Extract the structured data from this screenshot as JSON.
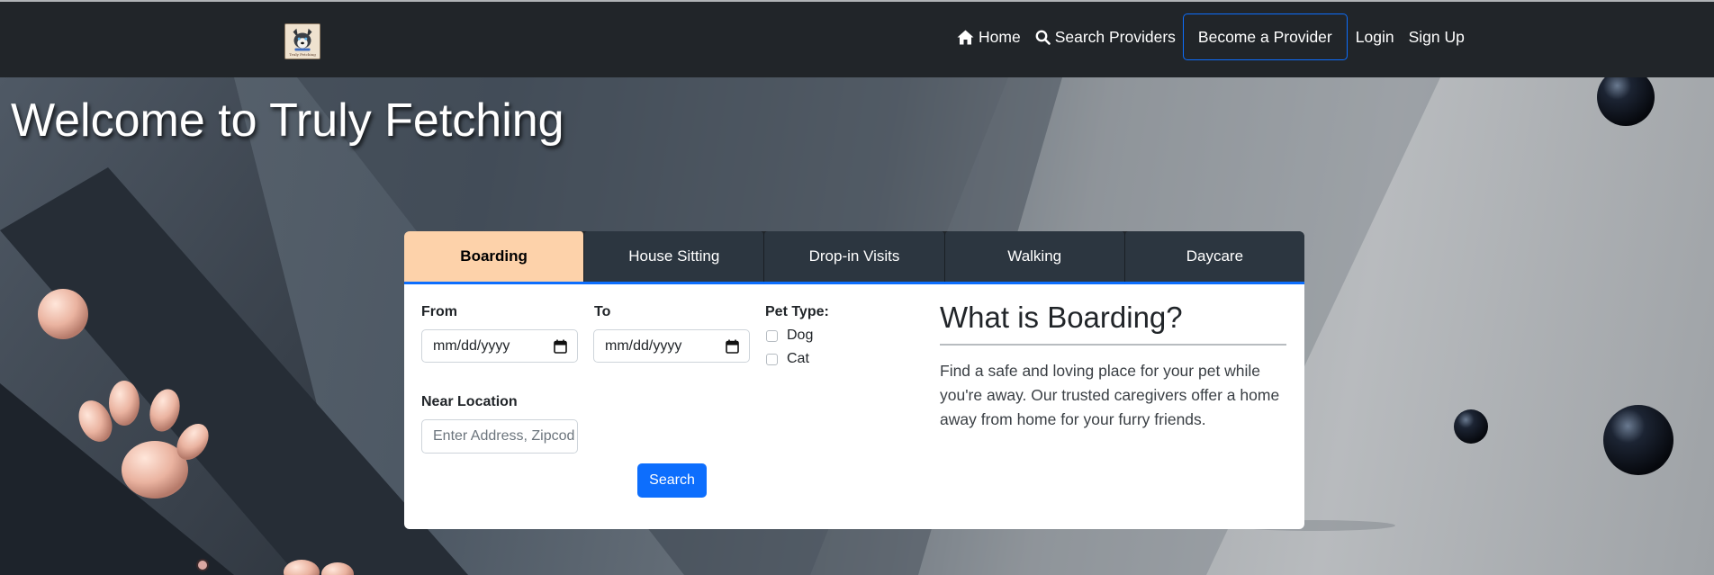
{
  "navbar": {
    "logo_text": "Truly Fetching",
    "links": [
      {
        "label": "Home",
        "icon": "home-icon"
      },
      {
        "label": "Search Providers",
        "icon": "search-icon"
      },
      {
        "label": "Become a Provider"
      },
      {
        "label": "Login"
      },
      {
        "label": "Sign Up"
      }
    ]
  },
  "hero": {
    "title": "Welcome to Truly Fetching"
  },
  "service_tabs": [
    {
      "label": "Boarding",
      "active": true
    },
    {
      "label": "House Sitting",
      "active": false
    },
    {
      "label": "Drop-in Visits",
      "active": false
    },
    {
      "label": "Walking",
      "active": false
    },
    {
      "label": "Daycare",
      "active": false
    }
  ],
  "search_form": {
    "from_label": "From",
    "from_value": "mm/dd/yyyy",
    "to_label": "To",
    "to_value": "mm/dd/yyyy",
    "pet_type_label": "Pet Type:",
    "pet_options": [
      {
        "label": "Dog",
        "checked": false
      },
      {
        "label": "Cat",
        "checked": false
      }
    ],
    "location_label": "Near Location",
    "location_placeholder": "Enter Address, Zipcode",
    "location_value": "",
    "search_button": "Search"
  },
  "info_panel": {
    "title": "What is Boarding?",
    "description": "Find a safe and loving place for your pet while you're away. Our trusted caregivers offer a home away from home for your furry friends."
  },
  "colors": {
    "navbar_bg": "#212529",
    "accent": "#0d6efd",
    "active_tab": "#fdd2aa",
    "tab_bg": "#2c3640"
  }
}
